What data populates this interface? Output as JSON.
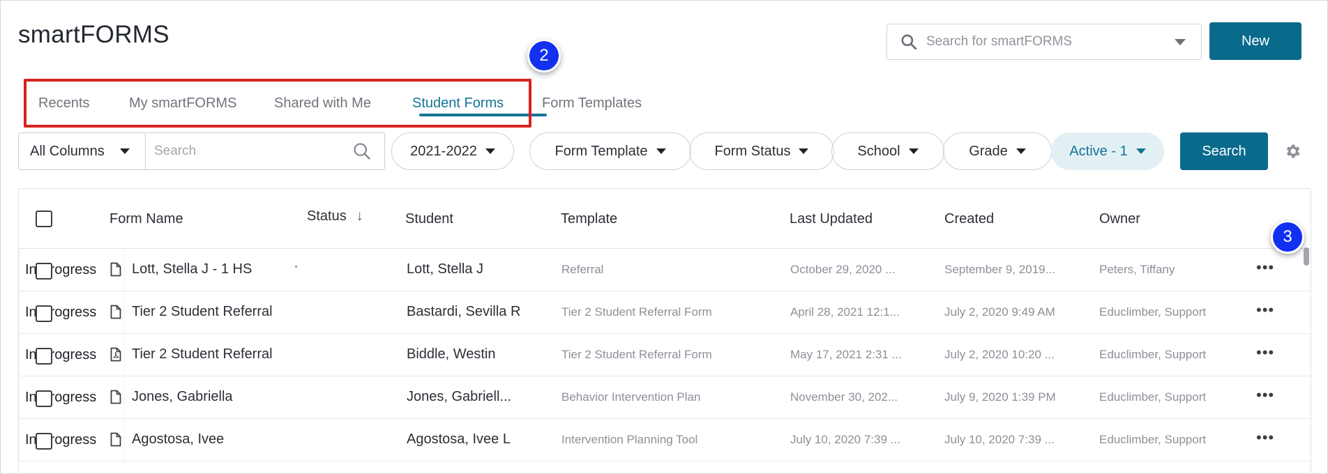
{
  "app": {
    "title": "smartFORMS"
  },
  "header": {
    "search_placeholder": "Search for smartFORMS",
    "new_label": "New"
  },
  "tabs": [
    {
      "label": "Recents",
      "active": false
    },
    {
      "label": "My smartFORMS",
      "active": false
    },
    {
      "label": "Shared with Me",
      "active": false
    },
    {
      "label": "Student Forms",
      "active": true
    },
    {
      "label": "Form Templates",
      "active": false
    }
  ],
  "callouts": {
    "tabs": "2",
    "row_actions": "3"
  },
  "filters": {
    "column_select": "All Columns",
    "search_placeholder": "Search",
    "year": "2021-2022",
    "form_template": "Form Template",
    "form_status": "Form Status",
    "school": "School",
    "grade": "Grade",
    "active": "Active - 1",
    "search_label": "Search"
  },
  "table": {
    "columns": [
      "Form Name",
      "Status",
      "Student",
      "Template",
      "Last Updated",
      "Created",
      "Owner"
    ],
    "rows": [
      {
        "name": "Lott, Stella J - 1 HS",
        "status": "In Progress",
        "student": "Lott, Stella J",
        "template": "Referral",
        "updated": "October 29, 2020 ...",
        "created": "September 9, 2019...",
        "owner": "Peters, Tiffany",
        "file_type": "doc"
      },
      {
        "name": "Tier 2 Student Referral",
        "status": "In Progress",
        "student": "Bastardi, Sevilla R",
        "template": "Tier 2 Student Referral Form",
        "updated": "April 28, 2021 12:1...",
        "created": "July 2, 2020 9:49 AM",
        "owner": "Educlimber, Support",
        "file_type": "doc"
      },
      {
        "name": "Tier 2 Student Referral",
        "status": "In Progress",
        "student": "Biddle, Westin",
        "template": "Tier 2 Student Referral Form",
        "updated": "May 17, 2021 2:31 ...",
        "created": "July 2, 2020 10:20 ...",
        "owner": "Educlimber, Support",
        "file_type": "pdf"
      },
      {
        "name": "Jones, Gabriella",
        "status": "In Progress",
        "student": "Jones, Gabriell...",
        "template": "Behavior Intervention Plan",
        "updated": "November 30, 202...",
        "created": "July 9, 2020 1:39 PM",
        "owner": "Educlimber, Support",
        "file_type": "doc"
      },
      {
        "name": "Agostosa, Ivee",
        "status": "In Progress",
        "student": "Agostosa, Ivee L",
        "template": "Intervention Planning Tool",
        "updated": "July 10, 2020 7:39 ...",
        "created": "July 10, 2020 7:39 ...",
        "owner": "Educlimber, Support",
        "file_type": "doc"
      }
    ],
    "more_label": "•••"
  },
  "colors": {
    "accent": "#0a6a8c",
    "highlight": "#d8221d",
    "callout": "#1230f0"
  }
}
